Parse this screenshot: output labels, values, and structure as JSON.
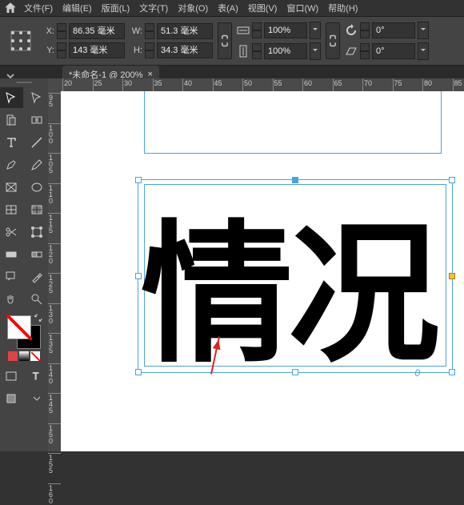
{
  "menu": {
    "items": [
      "文件(F)",
      "编辑(E)",
      "版面(L)",
      "文字(T)",
      "对象(O)",
      "表(A)",
      "视图(V)",
      "窗口(W)",
      "帮助(H)"
    ]
  },
  "control": {
    "x": "86.35 毫米",
    "y": "143 毫米",
    "w": "51.3 毫米",
    "h": "34.3 毫米",
    "scaleX": "100%",
    "scaleY": "100%",
    "rotate": "0°",
    "shear": "0°"
  },
  "tab": {
    "title": "*未命名-1 @ 200%"
  },
  "ruler_h": [
    20,
    25,
    30,
    35,
    40,
    45,
    50,
    55,
    60,
    65,
    70,
    75,
    80,
    85
  ],
  "ruler_v": [
    95,
    100,
    105,
    110,
    115,
    120,
    125,
    130,
    135,
    140,
    145,
    150,
    155,
    160
  ],
  "canvas": {
    "text": "情况",
    "rot": "0"
  }
}
